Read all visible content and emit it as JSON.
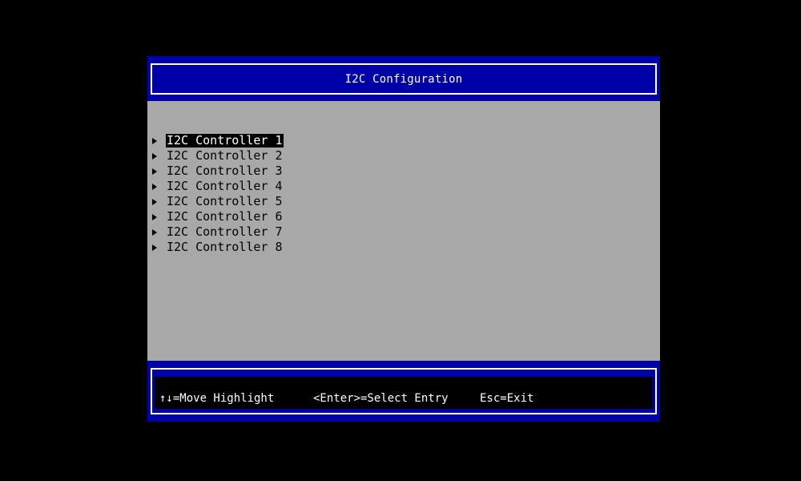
{
  "header": {
    "title": "I2C Configuration"
  },
  "menu": {
    "items": [
      {
        "label": "I2C Controller 1",
        "icon": "triangle-right-icon"
      },
      {
        "label": "I2C Controller 2",
        "icon": "triangle-right-icon"
      },
      {
        "label": "I2C Controller 3",
        "icon": "triangle-right-icon"
      },
      {
        "label": "I2C Controller 4",
        "icon": "triangle-right-icon"
      },
      {
        "label": "I2C Controller 5",
        "icon": "triangle-right-icon"
      },
      {
        "label": "I2C Controller 6",
        "icon": "triangle-right-icon"
      },
      {
        "label": "I2C Controller 7",
        "icon": "triangle-right-icon"
      },
      {
        "label": "I2C Controller 8",
        "icon": "triangle-right-icon"
      }
    ],
    "selected_index": 0
  },
  "footer": {
    "move_hint": "↑↓=Move Highlight",
    "select_hint": "<Enter>=Select Entry",
    "exit_hint": "Esc=Exit"
  },
  "colors": {
    "background": "#000000",
    "header_blue": "#0000a8",
    "content_gray": "#a8a8a8",
    "text_white": "#ffffff",
    "highlight_bg": "#000000"
  }
}
